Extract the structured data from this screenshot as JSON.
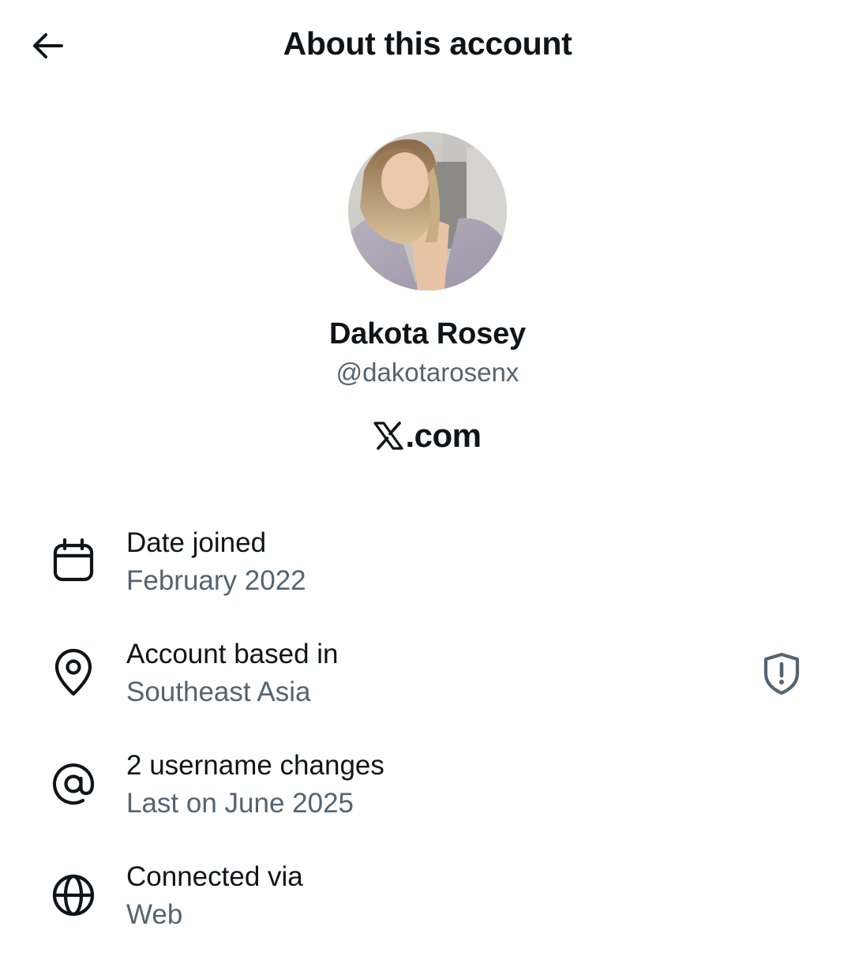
{
  "header": {
    "title": "About this account",
    "back_icon": "arrow-left-icon"
  },
  "profile": {
    "display_name": "Dakota Rosey",
    "handle": "@dakotarosenx",
    "platform_logo": "x-logo-icon",
    "platform_text": ".com"
  },
  "details": [
    {
      "icon": "calendar-icon",
      "label": "Date joined",
      "value": "February 2022"
    },
    {
      "icon": "location-pin-icon",
      "label": "Account based in",
      "value": "Southeast Asia",
      "action_icon": "shield-alert-icon"
    },
    {
      "icon": "at-sign-icon",
      "label": "2 username changes",
      "value": "Last on June 2025"
    },
    {
      "icon": "globe-icon",
      "label": "Connected via",
      "value": "Web"
    }
  ],
  "colors": {
    "primary_text": "#0f1419",
    "secondary_text": "#536471",
    "background": "#ffffff"
  }
}
